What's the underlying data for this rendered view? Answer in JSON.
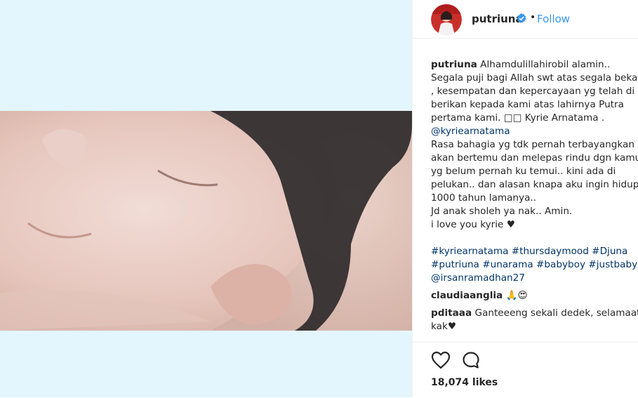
{
  "post": {
    "username": "putriuna",
    "follow_label": "Follow",
    "separator": "•",
    "caption_lines": [
      "Alhamdulillahirobil alamin..",
      "Segala puji bagi Allah swt atas segala bekah",
      ", kesempatan dan kepercayaan yg telah di",
      "berikan kepada kami atas lahirnya Putra",
      "pertama kami. □□ Kyrie Arnatama .",
      "@kyriearnatama",
      "Rasa bahagia yg tdk pernah terbayangkan",
      "akan bertemu dan melepas rindu dgn kamu",
      "yg belum pernah ku temui.. kini ada di",
      "pelukan.. dan alasan knapa aku ingin hidup",
      "1000 tahun lamanya..",
      "Jd anak sholeh ya nak.. Amin.",
      "i love you kyrie ♥"
    ],
    "hashtag_lines": [
      "#kyriearnatama #thursdaymood #Djuna",
      "#putriuna #unarama #babyboy #justbaby",
      "@irsanramadhan27"
    ],
    "comments": [
      {
        "username": "claudiaanglia",
        "text": "🙏😍",
        "extra": ""
      },
      {
        "username": "pditaaa",
        "text": "Ganteeeng sekali dedek, selamaat",
        "extra": "kak♥"
      }
    ],
    "likes": "18,074 likes"
  },
  "colors": {
    "link": "#003569",
    "follow": "#3897f0",
    "verified": "#3897f0",
    "media_bg": "#e4f6fd"
  },
  "icons": {
    "like": "heart-outline-icon",
    "comment": "speech-bubble-icon",
    "verified": "verified-badge-icon"
  }
}
